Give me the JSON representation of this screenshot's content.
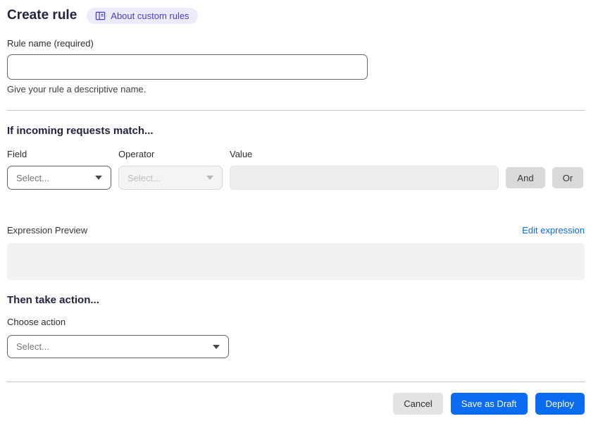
{
  "page": {
    "title": "Create rule",
    "about_badge": {
      "label": "About custom rules",
      "icon": "book-icon",
      "bg_color": "#ecebfb",
      "text_color": "#4540cf"
    }
  },
  "rule_name": {
    "label": "Rule name (required)",
    "value": "",
    "placeholder": "",
    "helper": "Give your rule a descriptive name."
  },
  "match_section": {
    "heading": "If incoming requests match...",
    "field": {
      "label": "Field",
      "selected": "Select...",
      "enabled": true,
      "icon": "chevron-down-icon"
    },
    "operator": {
      "label": "Operator",
      "selected": "Select...",
      "enabled": false,
      "icon": "chevron-down-icon"
    },
    "value": {
      "label": "Value",
      "value": "",
      "enabled": false
    },
    "and_button_label": "And",
    "or_button_label": "Or",
    "expression_preview_label": "Expression Preview",
    "edit_expression_link": "Edit expression",
    "expression_value": ""
  },
  "action_section": {
    "heading": "Then take action...",
    "choose_action_label": "Choose action",
    "action_select": {
      "selected": "Select...",
      "enabled": true,
      "icon": "chevron-down-icon"
    }
  },
  "footer": {
    "cancel_label": "Cancel",
    "save_draft_label": "Save as Draft",
    "deploy_label": "Deploy"
  },
  "colors": {
    "primary_blue": "#0b6cf2",
    "link_blue": "#0b6cf3",
    "heading_dark": "#212340",
    "disabled_bg": "#f4f4f4",
    "chip_gray": "#d9d9d9",
    "preview_gray": "#f1f1f1"
  }
}
